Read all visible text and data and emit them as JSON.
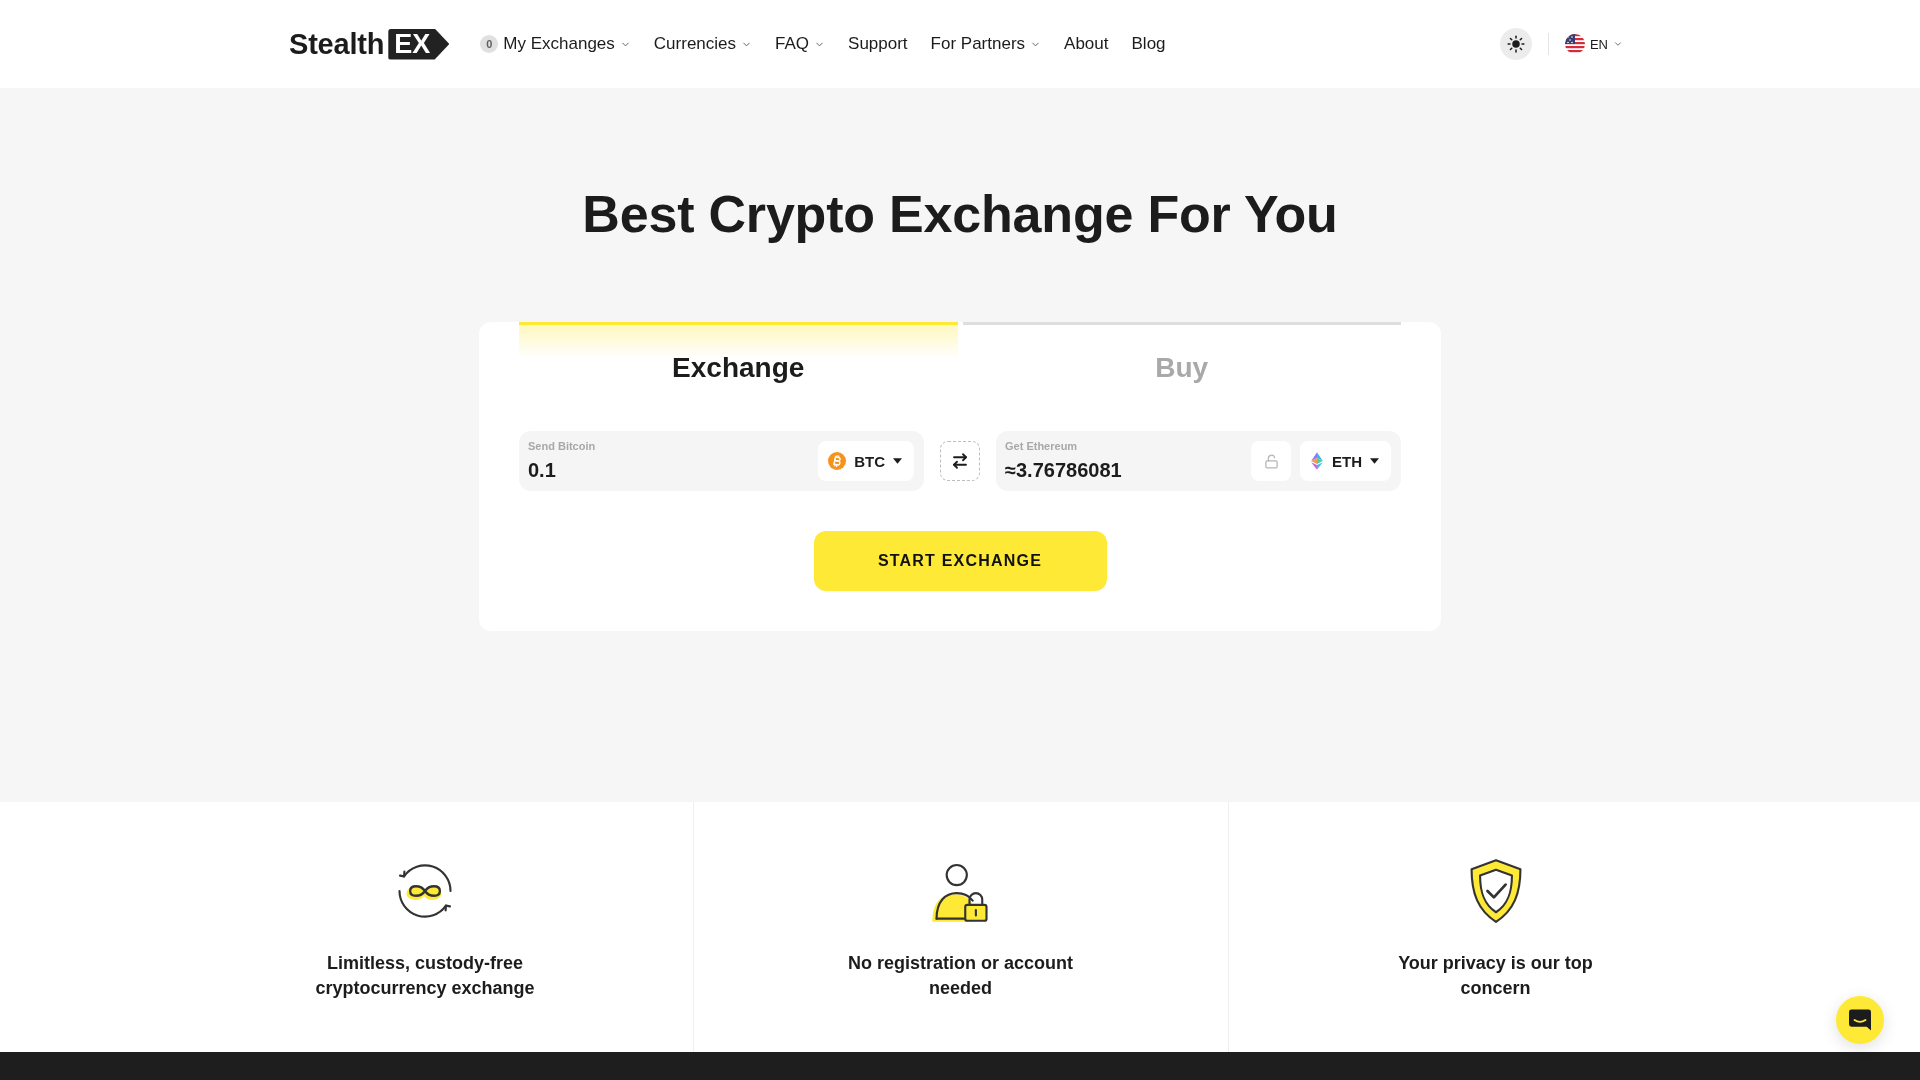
{
  "header": {
    "logo": {
      "text": "Stealth",
      "badge": "EX"
    },
    "nav": [
      {
        "label": "My Exchanges",
        "count": "0",
        "dropdown": true
      },
      {
        "label": "Currencies",
        "dropdown": true
      },
      {
        "label": "FAQ",
        "dropdown": true
      },
      {
        "label": "Support",
        "dropdown": false
      },
      {
        "label": "For Partners",
        "dropdown": true
      },
      {
        "label": "About",
        "dropdown": false
      },
      {
        "label": "Blog",
        "dropdown": false
      }
    ],
    "language": "EN"
  },
  "hero": {
    "title": "Best Crypto Exchange For You"
  },
  "exchange_card": {
    "tabs": [
      {
        "label": "Exchange",
        "selected": true
      },
      {
        "label": "Buy",
        "selected": false
      }
    ],
    "send": {
      "label": "Send Bitcoin",
      "value": "0.1",
      "currency": "BTC",
      "kind": "btc"
    },
    "receive": {
      "label": "Get Ethereum",
      "value": "≈3.76786081",
      "currency": "ETH",
      "kind": "eth",
      "rate_locked": false
    },
    "button": "START EXCHANGE"
  },
  "features": [
    {
      "kind": "infinity",
      "text": "Limitless, custody-free cryptocurrency exchange"
    },
    {
      "kind": "person_lock",
      "text": "No registration or account needed"
    },
    {
      "kind": "shield",
      "text": "Your privacy is our top concern"
    }
  ]
}
